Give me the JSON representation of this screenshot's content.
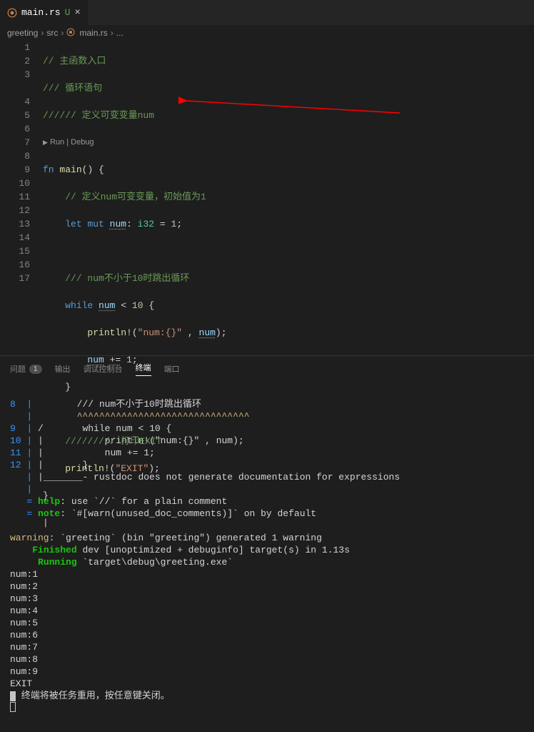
{
  "tab": {
    "icon": "rust",
    "title": "main.rs",
    "dirty": "U"
  },
  "breadcrumb": {
    "part1": "greeting",
    "part2": "src",
    "part3": "main.rs",
    "part4": "..."
  },
  "codelens": "Run | Debug",
  "lines": {
    "l1": "// 主函数入口",
    "l2": "/// 循环语句",
    "l3": "////// 定义可变变量num",
    "l5": "// 定义num可变变量，初始值为1",
    "l8": "/// num不小于10时跳出循环",
    "l14": "///////// 打印EXIT",
    "kw_fn": "fn",
    "fn_main": "main",
    "kw_let": "let",
    "kw_mut": "mut",
    "var_num": "num",
    "type_i32": "i32",
    "num_1": "1",
    "kw_while": "while",
    "num_10": "10",
    "macro_println": "println!",
    "str_numfmt": "\"num:{}\"",
    "op_plus": "+=",
    "num_1b": "1",
    "str_exit": "\"EXIT\""
  },
  "panel": {
    "tabs": {
      "problems": "问题",
      "problems_count": "1",
      "output": "输出",
      "debug": "调试控制台",
      "terminal": "终端",
      "ports": "端口"
    }
  },
  "terminal": {
    "ln8_a": "8",
    "ln8_b": "        /// num不小于10时跳出循环",
    "ln8_c": "        ^^^^^^^^^^^^^^^^^^^^^^^^^^^^^^^",
    "ln9": "9",
    "ln9_b": "/       while num < 10 {",
    "ln10": "10",
    "ln10_b": "|           println!(\"num:{}\" , num);",
    "ln11": "11",
    "ln11_b": "|           num += 1;",
    "ln12": "12",
    "ln12_b": "|       }",
    "rustdoc": "|_______- rustdoc does not generate documentation for expressions",
    "help": "help",
    "help_txt": ": use `//` for a plain comment",
    "note": "note",
    "note_txt": ": `#[warn(unused_doc_comments)]` on by default",
    "warning": "warning",
    "warning_txt": ": `greeting` (bin \"greeting\") generated 1 warning",
    "finished": "Finished",
    "finished_txt": " dev [unoptimized + debuginfo] target(s) in 1.13s",
    "running": "Running",
    "running_txt": " `target\\debug\\greeting.exe`",
    "out": [
      "num:1",
      "num:2",
      "num:3",
      "num:4",
      "num:5",
      "num:6",
      "num:7",
      "num:8",
      "num:9",
      "EXIT"
    ],
    "footer": " 终端将被任务重用，按任意键关闭。"
  }
}
